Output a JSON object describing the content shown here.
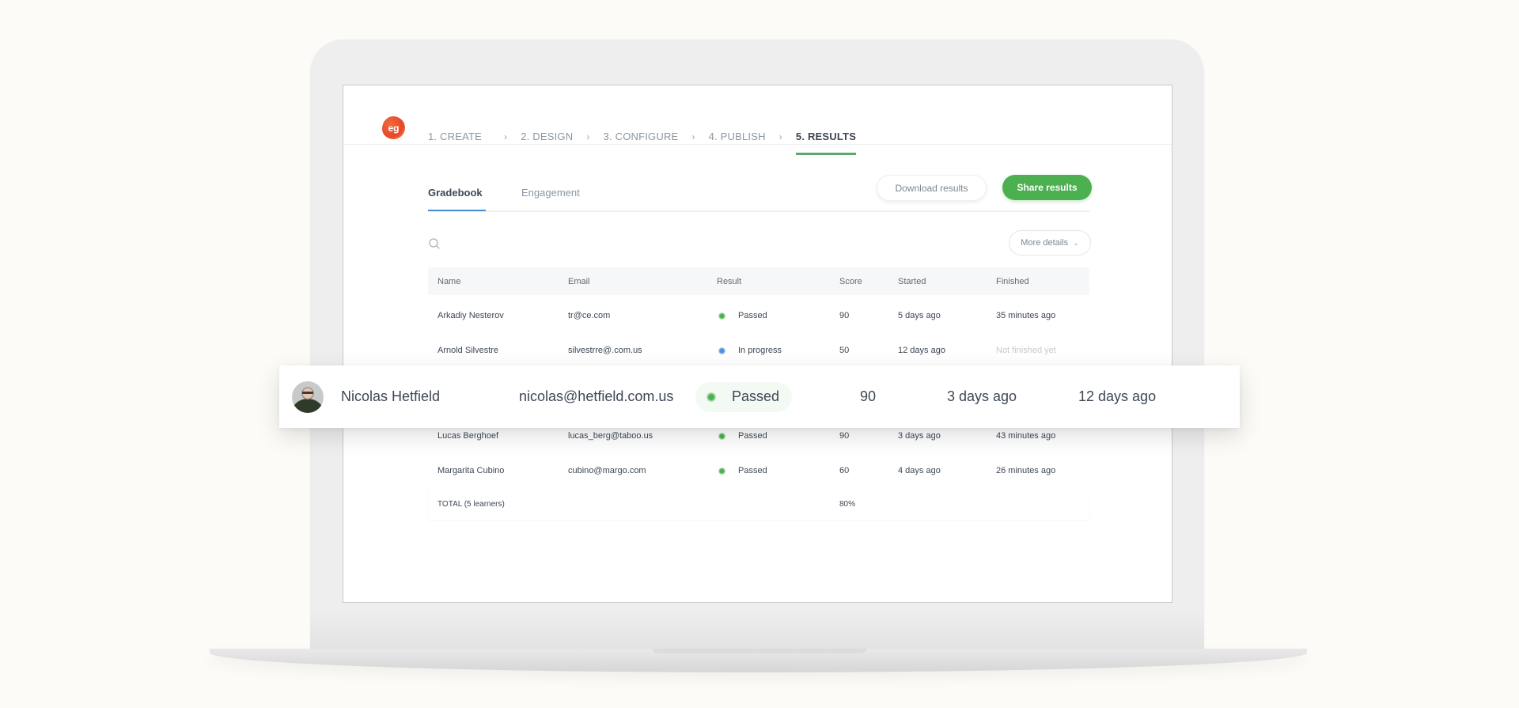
{
  "nav": {
    "logo_text": "eg",
    "steps": [
      {
        "label": "1. CREATE",
        "active": false
      },
      {
        "label": "2. DESIGN",
        "active": false
      },
      {
        "label": "3. CONFIGURE",
        "active": false
      },
      {
        "label": "4. PUBLISH",
        "active": false
      },
      {
        "label": "5. RESULTS",
        "active": true
      }
    ],
    "separator": "›"
  },
  "tabs": [
    {
      "label": "Gradebook",
      "active": true
    },
    {
      "label": "Engagement",
      "active": false
    }
  ],
  "toolbar": {
    "download_label": "Download results",
    "share_label": "Share results",
    "more_details_label": "More details",
    "more_details_chevron": "⌄"
  },
  "colors": {
    "accent_green": "#4caf50",
    "tab_underline_blue": "#4a90d9",
    "status_passed": "#4caf50",
    "status_in_progress": "#4a90d9"
  },
  "table": {
    "headers": [
      "Name",
      "Email",
      "Result",
      "Score",
      "Started",
      "Finished"
    ],
    "rows": [
      {
        "name": "Arkadiy Nesterov",
        "email": "tr@ce.com",
        "result": "Passed",
        "status": "passed",
        "score": "90",
        "started": "5 days ago",
        "finished": "35 minutes ago"
      },
      {
        "name": "Arnold Silvestre",
        "email": "silvestrre@.com.us",
        "result": "In progress",
        "status": "in-progress",
        "score": "50",
        "started": "12 days ago",
        "finished": "Not finished yet"
      },
      {
        "name": "Lucas Berghoef",
        "email": "lucas_berg@taboo.us",
        "result": "Passed",
        "status": "passed",
        "score": "90",
        "started": "3 days ago",
        "finished": "43 minutes ago"
      },
      {
        "name": "Margarita Cubino",
        "email": "cubino@margo.com",
        "result": "Passed",
        "status": "passed",
        "score": "60",
        "started": "4 days ago",
        "finished": "26 minutes ago"
      }
    ],
    "total": {
      "label": "TOTAL (5 learners)",
      "score": "80%"
    }
  },
  "highlight": {
    "name": "Nicolas Hetfield",
    "email": "nicolas@hetfield.com.us",
    "result": "Passed",
    "score": "90",
    "started": "3 days ago",
    "finished": "12 days ago"
  }
}
